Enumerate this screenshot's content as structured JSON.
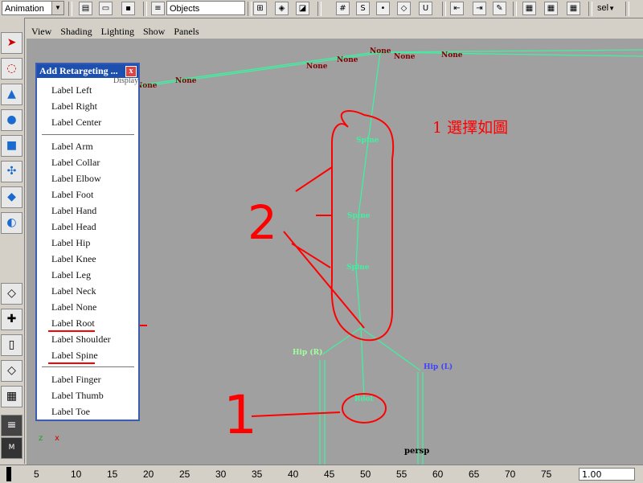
{
  "toolbar": {
    "mode_combo": "Animation",
    "selection_combo": "Objects",
    "sel_label": "sel"
  },
  "viewport": {
    "menu": [
      "View",
      "Shading",
      "Lighting",
      "Show",
      "Panels"
    ],
    "camera_label": "persp",
    "axis_x": "x",
    "axis_z": "z",
    "joint_none": "None",
    "joint_spine": "Spine",
    "joint_root": "Root",
    "joint_hip_r": "Hip (R)",
    "joint_hip_l": "Hip (L)",
    "annotation_text": "1  選擇如圖",
    "annotation_num_1": "1",
    "annotation_num_2": "2"
  },
  "popup": {
    "title": "Add Retargeting ...",
    "close": "x",
    "behind_text": "Display",
    "items_group1": [
      "Label Left",
      "Label Right",
      "Label Center"
    ],
    "items_group2": [
      "Label Arm",
      "Label Collar",
      "Label Elbow",
      "Label Foot",
      "Label Hand",
      "Label Head",
      "Label Hip",
      "Label Knee",
      "Label Leg",
      "Label Neck",
      "Label None",
      "Label Root",
      "Label Shoulder",
      "Label Spine"
    ],
    "items_group3": [
      "Label Finger",
      "Label Thumb",
      "Label Toe"
    ]
  },
  "timeline": {
    "ticks": [
      "5",
      "10",
      "15",
      "20",
      "25",
      "30",
      "35",
      "40",
      "45",
      "50",
      "55",
      "60",
      "65",
      "70",
      "75"
    ],
    "current_frame": "1.00"
  },
  "colors": {
    "joint": "#40f0a0",
    "annotation": "#ff0000",
    "none_label": "#800000",
    "hip_l": "#4040ff",
    "hip_r": "#a0ffa0"
  }
}
